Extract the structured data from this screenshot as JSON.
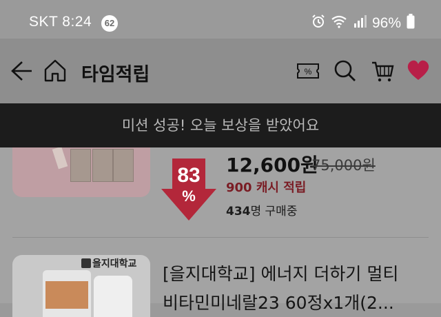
{
  "status_bar": {
    "carrier_time": "SKT 8:24",
    "notification_count": "62",
    "battery": "96%",
    "icons": [
      "alarm-icon",
      "wifi-icon",
      "signal-icon",
      "battery-icon"
    ]
  },
  "header": {
    "title": "타임적립",
    "back_icon": "back-arrow-icon",
    "home_icon": "home-icon",
    "coupon_label": "%",
    "search_icon": "search-icon",
    "cart_icon": "cart-icon",
    "heart_icon": "heart-icon",
    "heart_color": "#c41e4a"
  },
  "banner": {
    "text": "미션 성공! 오늘 보상을 받았어요"
  },
  "products": [
    {
      "discount_num": "83",
      "discount_pct": "%",
      "price": "12,600원",
      "original_price": "75,000원",
      "cash_reward": "900 캐시 적립",
      "buyers_count": "434",
      "buyers_suffix": "명 구매중"
    },
    {
      "brand_label": "을지대학교",
      "title_line1": "[을지대학교] 에너지 더하기 멀티",
      "title_line2": "비타민미네랄23 60정x1개(2..."
    }
  ]
}
